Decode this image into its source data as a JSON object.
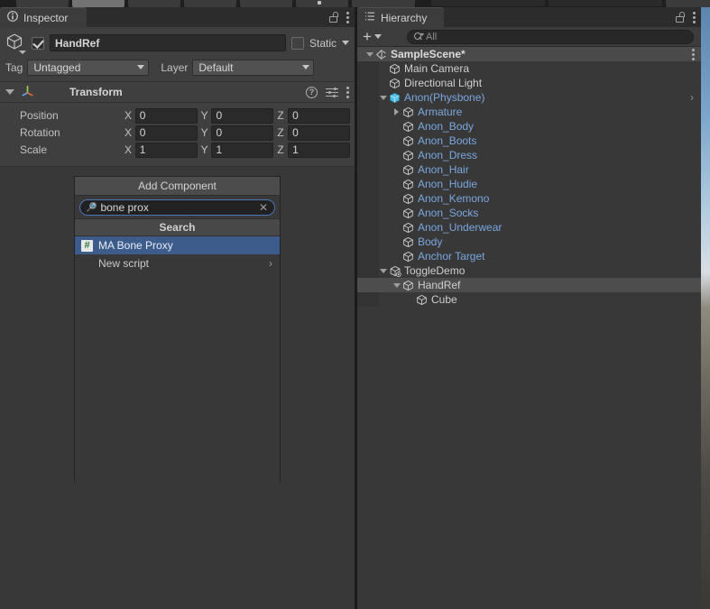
{
  "window": {
    "app": "Unity Editor",
    "theme_bg": "#383838",
    "accent_blue": "#3d5c8c",
    "prefab_blue": "#7ba6e0"
  },
  "inspector": {
    "tab_label": "Inspector",
    "tab_icon": "info-icon",
    "lock_icon": "lock-open-icon",
    "menu_icon": "kebab-menu-icon",
    "object_header": {
      "enabled": true,
      "icon": "gameobject-cube-icon",
      "name_value": "HandRef",
      "static_label": "Static",
      "static_checked": false,
      "tag_label": "Tag",
      "tag_value": "Untagged",
      "layer_label": "Layer",
      "layer_value": "Default"
    },
    "transform": {
      "title": "Transform",
      "icon": "transform-axis-icon",
      "expanded": true,
      "help_icon": "help-icon",
      "preset_icon": "preset-settings-icon",
      "menu_icon": "kebab-menu-icon",
      "rows": [
        {
          "label": "Position",
          "x": "0",
          "y": "0",
          "z": "0"
        },
        {
          "label": "Rotation",
          "x": "0",
          "y": "0",
          "z": "0"
        },
        {
          "label": "Scale",
          "x": "1",
          "y": "1",
          "z": "1"
        }
      ],
      "axis_labels": {
        "x": "X",
        "y": "Y",
        "z": "Z"
      }
    },
    "add_component": {
      "button_label": "Add Component",
      "search_icon": "search-icon",
      "search_value": "bone prox",
      "search_placeholder": "Search",
      "clear_icon": "clear-x-icon",
      "section_header": "Search",
      "items": [
        {
          "label": "MA Bone Proxy",
          "icon": "cs-script-icon",
          "selected": true,
          "has_submenu": false
        },
        {
          "label": "New script",
          "icon": "",
          "selected": false,
          "has_submenu": true
        }
      ]
    }
  },
  "hierarchy": {
    "tab_label": "Hierarchy",
    "tab_icon": "hierarchy-list-icon",
    "lock_icon": "lock-open-icon",
    "menu_icon": "kebab-menu-icon",
    "toolbar": {
      "add_label": "+",
      "add_caret_icon": "chevron-down-icon",
      "search_icon": "search-dropdown-icon",
      "search_placeholder": "All",
      "search_value": ""
    },
    "tree": [
      {
        "label": "SampleScene*",
        "indent": 0,
        "icon": "scene-icon",
        "expander": "down",
        "type": "scene",
        "selected": false,
        "kebab": true,
        "chevron": false
      },
      {
        "label": "Main Camera",
        "indent": 1,
        "icon": "gameobject-icon",
        "expander": "none",
        "type": "normal",
        "selected": false,
        "kebab": false,
        "chevron": false
      },
      {
        "label": "Directional Light",
        "indent": 1,
        "icon": "gameobject-icon",
        "expander": "none",
        "type": "normal",
        "selected": false,
        "kebab": false,
        "chevron": false
      },
      {
        "label": "Anon(Physbone)",
        "indent": 1,
        "icon": "prefab-cube-icon",
        "expander": "down",
        "type": "prefab",
        "selected": false,
        "kebab": false,
        "chevron": true
      },
      {
        "label": "Armature",
        "indent": 2,
        "icon": "gameobject-icon",
        "expander": "right",
        "type": "prefab",
        "selected": false,
        "kebab": false,
        "chevron": false
      },
      {
        "label": "Anon_Body",
        "indent": 2,
        "icon": "gameobject-icon",
        "expander": "none",
        "type": "prefab",
        "selected": false,
        "kebab": false,
        "chevron": false
      },
      {
        "label": "Anon_Boots",
        "indent": 2,
        "icon": "gameobject-icon",
        "expander": "none",
        "type": "prefab",
        "selected": false,
        "kebab": false,
        "chevron": false
      },
      {
        "label": "Anon_Dress",
        "indent": 2,
        "icon": "gameobject-icon",
        "expander": "none",
        "type": "prefab",
        "selected": false,
        "kebab": false,
        "chevron": false
      },
      {
        "label": "Anon_Hair",
        "indent": 2,
        "icon": "gameobject-icon",
        "expander": "none",
        "type": "prefab",
        "selected": false,
        "kebab": false,
        "chevron": false
      },
      {
        "label": "Anon_Hudie",
        "indent": 2,
        "icon": "gameobject-icon",
        "expander": "none",
        "type": "prefab",
        "selected": false,
        "kebab": false,
        "chevron": false
      },
      {
        "label": "Anon_Kemono",
        "indent": 2,
        "icon": "gameobject-icon",
        "expander": "none",
        "type": "prefab",
        "selected": false,
        "kebab": false,
        "chevron": false
      },
      {
        "label": "Anon_Socks",
        "indent": 2,
        "icon": "gameobject-icon",
        "expander": "none",
        "type": "prefab",
        "selected": false,
        "kebab": false,
        "chevron": false
      },
      {
        "label": "Anon_Underwear",
        "indent": 2,
        "icon": "gameobject-icon",
        "expander": "none",
        "type": "prefab",
        "selected": false,
        "kebab": false,
        "chevron": false
      },
      {
        "label": "Body",
        "indent": 2,
        "icon": "gameobject-icon",
        "expander": "none",
        "type": "prefab",
        "selected": false,
        "kebab": false,
        "chevron": false
      },
      {
        "label": "Anchor Target",
        "indent": 2,
        "icon": "gameobject-icon",
        "expander": "none",
        "type": "prefab",
        "selected": false,
        "kebab": false,
        "chevron": false
      },
      {
        "label": "ToggleDemo",
        "indent": 1,
        "icon": "gameobject-add-icon",
        "expander": "down",
        "type": "normal",
        "selected": false,
        "kebab": false,
        "chevron": false
      },
      {
        "label": "HandRef",
        "indent": 2,
        "icon": "gameobject-icon",
        "expander": "down",
        "type": "normal",
        "selected": true,
        "kebab": false,
        "chevron": false
      },
      {
        "label": "Cube",
        "indent": 3,
        "icon": "gameobject-icon",
        "expander": "none",
        "type": "normal",
        "selected": false,
        "kebab": false,
        "chevron": false
      }
    ]
  }
}
